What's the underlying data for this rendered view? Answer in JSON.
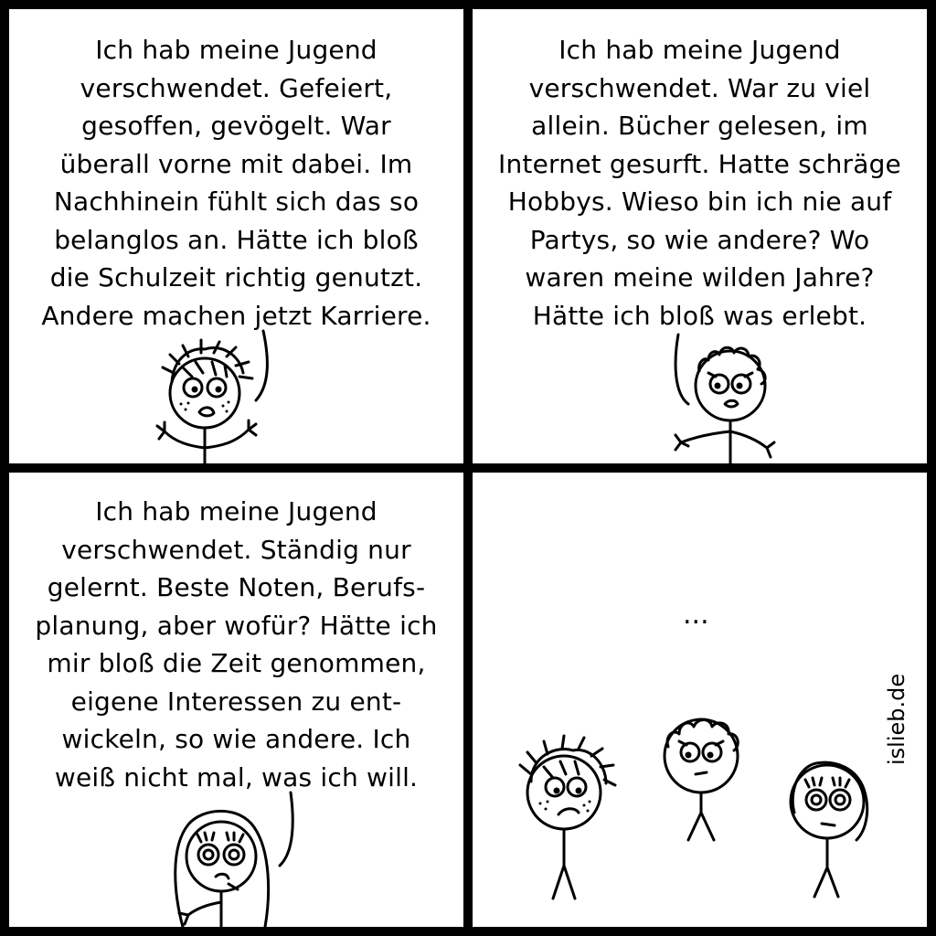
{
  "panels": [
    {
      "lines": [
        "Ich hab meine Jugend",
        "verschwendet. Gefeiert,",
        "gesoffen, gevögelt. War",
        "überall vorne mit dabei. Im",
        "Nachhinein fühlt sich das so",
        "belanglos an. Hätte ich bloß",
        "die Schulzeit richtig genutzt.",
        "Andere machen jetzt Karriere."
      ]
    },
    {
      "lines": [
        "Ich hab meine Jugend",
        "verschwendet. War zu viel",
        "allein. Bücher gelesen, im",
        "Internet gesurft. Hatte schräge",
        "Hobbys. Wieso bin ich nie auf",
        "Partys, so wie andere? Wo",
        "waren meine wilden Jahre?",
        "Hätte ich bloß was erlebt."
      ]
    },
    {
      "lines": [
        "Ich hab meine Jugend",
        "verschwendet. Ständig nur",
        "gelernt. Beste Noten, Berufs-",
        "planung, aber wofür? Hätte ich",
        "mir bloß die Zeit genommen,",
        "eigene Interessen zu ent-",
        "wickeln, so wie andere. Ich",
        "weiß nicht mal, was ich will."
      ]
    },
    {
      "ellipsis": "...",
      "signature": "islieb.de"
    }
  ]
}
